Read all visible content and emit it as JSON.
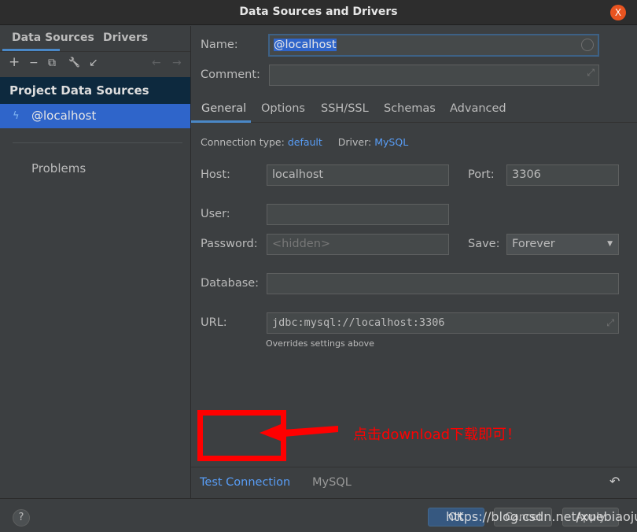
{
  "window": {
    "title": "Data Sources and Drivers",
    "close": "X"
  },
  "left": {
    "tabs": [
      "Data Sources",
      "Drivers"
    ],
    "toolbar": [
      "+",
      "−",
      "⧉",
      "🔧",
      "↙",
      "←",
      "→"
    ],
    "section": "Project Data Sources",
    "selected_item": "@localhost",
    "problems": "Problems"
  },
  "form": {
    "name_label": "Name:",
    "name_value": "@localhost",
    "comment_label": "Comment:",
    "comment_value": "",
    "tabs": [
      "General",
      "Options",
      "SSH/SSL",
      "Schemas",
      "Advanced"
    ],
    "conn_type_label": "Connection type:",
    "conn_type": "default",
    "driver_label": "Driver:",
    "driver": "MySQL",
    "host_label": "Host:",
    "host": "localhost",
    "port_label": "Port:",
    "port": "3306",
    "user_label": "User:",
    "user": "",
    "password_label": "Password:",
    "password_placeholder": "<hidden>",
    "save_label": "Save:",
    "save_value": "Forever",
    "database_label": "Database:",
    "database": "",
    "url_label": "URL:",
    "url": "jdbc:mysql://localhost:3306",
    "url_hint": "Overrides settings above"
  },
  "footer": {
    "test_connection": "Test Connection",
    "driver": "MySQL"
  },
  "annotation": {
    "text": "点击download下载即可！",
    "color": "#ff0000"
  },
  "buttons": {
    "help": "?",
    "ok": "OK",
    "cancel": "Cancel",
    "apply": "Apply"
  },
  "watermark": "https://blog.csdn.net/xuebiaojun"
}
